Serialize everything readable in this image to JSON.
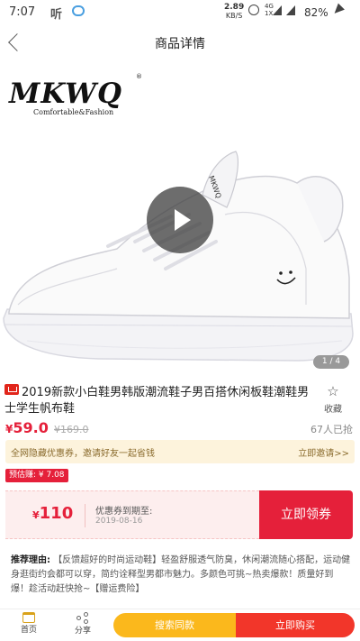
{
  "status_bar": {
    "time": "7:07",
    "app_glyph": "听",
    "net_speed": "2.89",
    "net_unit": "KB/S",
    "signal_label": "4G",
    "signal_sub": "1X",
    "battery": "82%"
  },
  "header": {
    "title": "商品详情"
  },
  "hero": {
    "brand": "MKWQ",
    "brand_registered": "®",
    "brand_tagline": "Comfortable&Fashion",
    "tongue_label": "MKWQ",
    "pager": "1 / 4"
  },
  "product": {
    "title": "2019新款小白鞋男韩版潮流鞋子男百搭休闲板鞋潮鞋男士学生帆布鞋",
    "favorite_label": "收藏",
    "price_symbol": "¥",
    "price": "59.0",
    "old_price": "¥169.0",
    "sold": "67人已抢"
  },
  "invite": {
    "text": "全网隐藏优惠券，邀请好友一起省钱",
    "link": "立即邀请>>"
  },
  "estimate": {
    "label": "预估赚: ¥ 7.08"
  },
  "coupon": {
    "symbol": "¥",
    "amount": "110",
    "label": "优惠券到期至:",
    "date": "2019-08-16",
    "button": "立即领券"
  },
  "recommend": {
    "label": "推荐理由:",
    "text": "【反馈超好的时尚运动鞋】轻盈舒服透气防臭，休闲潮流随心搭配，运动健身逛街约会都可以穿，简约诠释型男都市魅力。多颜色可挑~热卖爆款！质量好到爆！趁活动赶快抢~【赠运费险】"
  },
  "bottom_bar": {
    "home": "首页",
    "share": "分享",
    "search_same": "搜索同款",
    "buy_now": "立即购买"
  }
}
